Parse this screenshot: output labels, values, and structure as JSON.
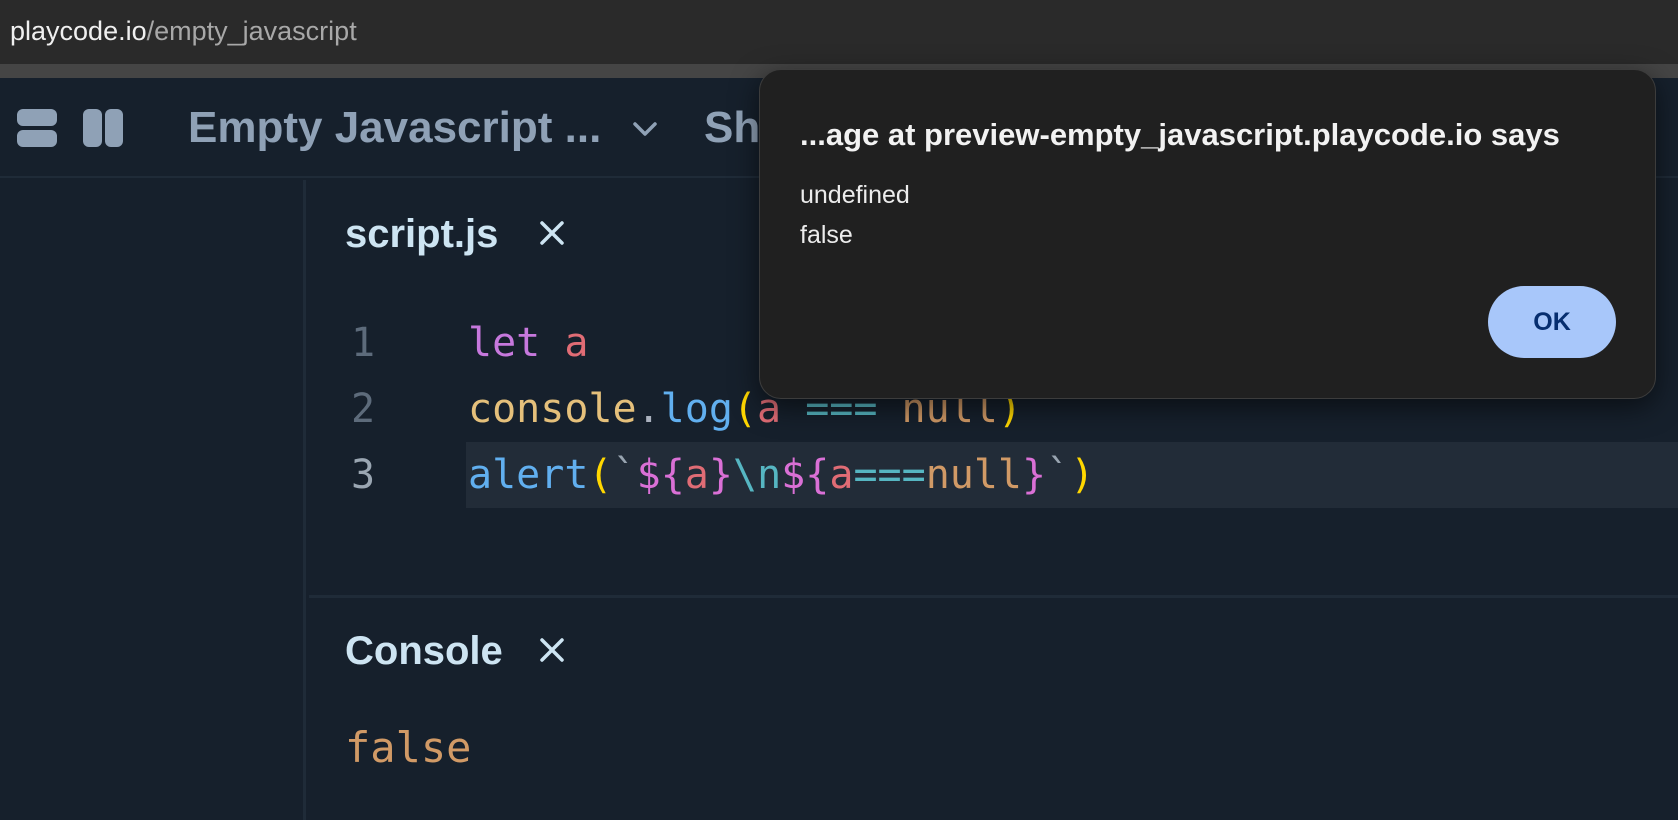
{
  "browser": {
    "url_host": "playcode.io",
    "url_path": "/empty_javascript"
  },
  "header": {
    "project_title": "Empty Javascript ...",
    "share_label": "Sh"
  },
  "editor": {
    "tab_title": "script.js",
    "line_numbers": [
      "1",
      "2",
      "3"
    ],
    "line1": {
      "kw": "let",
      "var": "a"
    },
    "line2": {
      "obj": "console",
      "dot": ".",
      "fn": "log",
      "open": "(",
      "var": "a",
      "op": "===",
      "nul": "null",
      "close": ")"
    },
    "line3": {
      "fn": "alert",
      "open": "(",
      "tick1": "`",
      "dollar1": "$",
      "b1": "{",
      "var1": "a",
      "b2": "}",
      "esc": "\\n",
      "dollar2": "$",
      "b3": "{",
      "var2": "a",
      "op": "===",
      "nul": "null",
      "b4": "}",
      "tick2": "`",
      "close": ")"
    }
  },
  "console": {
    "title": "Console",
    "output": "false"
  },
  "dialog": {
    "title": "...age at preview-empty_javascript.playcode.io says",
    "message_lines": [
      "undefined",
      "false"
    ],
    "ok_label": "OK"
  }
}
